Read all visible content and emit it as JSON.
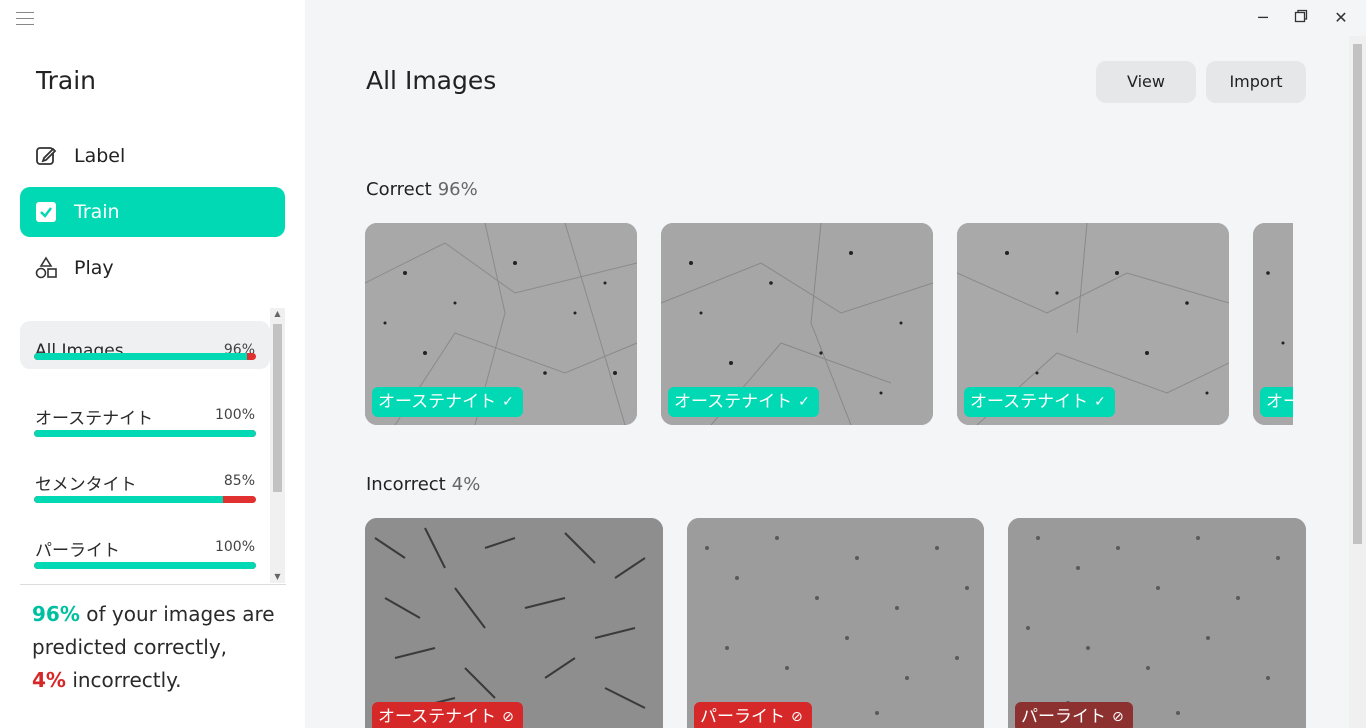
{
  "sidebar": {
    "title": "Train",
    "nav": [
      {
        "label": "Label",
        "icon": "pencil-icon"
      },
      {
        "label": "Train",
        "icon": "checkbox-icon"
      },
      {
        "label": "Play",
        "icon": "shapes-icon"
      }
    ],
    "classes": [
      {
        "name": "All Images",
        "pct": "96%",
        "value": 0.96
      },
      {
        "name": "オーステナイト",
        "pct": "100%",
        "value": 1.0
      },
      {
        "name": "セメンタイト",
        "pct": "85%",
        "value": 0.85
      },
      {
        "name": "パーライト",
        "pct": "100%",
        "value": 1.0
      }
    ],
    "summary": {
      "good_pct": "96%",
      "good_text": " of your images are predicted correctly,",
      "bad_pct": "4%",
      "bad_text": " incorrectly."
    }
  },
  "main": {
    "title": "All Images",
    "view_label": "View",
    "import_label": "Import",
    "correct": {
      "title": "Correct",
      "pct": "96%",
      "images": [
        {
          "label": "オーステナイト",
          "mark": "✓"
        },
        {
          "label": "オーステナイト",
          "mark": "✓"
        },
        {
          "label": "オーステナイト",
          "mark": "✓"
        },
        {
          "label": "オー",
          "mark": ""
        }
      ]
    },
    "incorrect": {
      "title": "Incorrect",
      "pct": "4%",
      "images": [
        {
          "label": "オーステナイト",
          "mark": "⊘"
        },
        {
          "label": "パーライト",
          "mark": "⊘"
        },
        {
          "label": "パーライト",
          "mark": "⊘"
        }
      ]
    }
  },
  "colors": {
    "accent": "#00d9b4",
    "error": "#d62828"
  }
}
